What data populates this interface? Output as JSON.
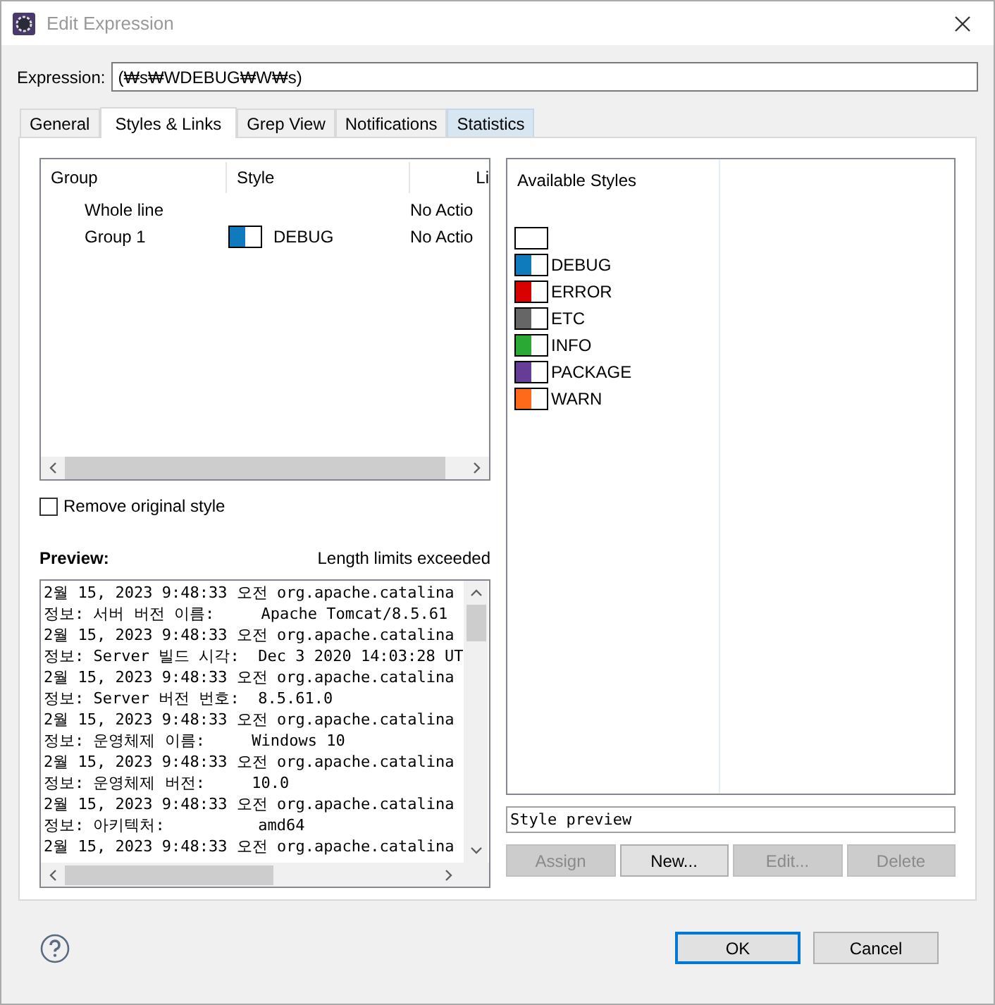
{
  "window": {
    "title": "Edit Expression"
  },
  "expression": {
    "label": "Expression:",
    "value": "(₩s₩WDEBUG₩W₩s)"
  },
  "tabs": [
    {
      "label": "General",
      "selected": false,
      "hovered": false
    },
    {
      "label": "Styles & Links",
      "selected": true,
      "hovered": false
    },
    {
      "label": "Grep View",
      "selected": false,
      "hovered": false
    },
    {
      "label": "Notifications",
      "selected": false,
      "hovered": false
    },
    {
      "label": "Statistics",
      "selected": false,
      "hovered": true
    }
  ],
  "groups_table": {
    "columns": [
      "Group",
      "Style",
      "Li"
    ],
    "rows": [
      {
        "group": "Whole line",
        "link": "No Actio"
      },
      {
        "group": "Group 1",
        "style": {
          "name": "DEBUG",
          "color": "#0f7bbd"
        },
        "link": "No Actio"
      }
    ]
  },
  "remove_original_style": {
    "label": "Remove original style",
    "checked": false
  },
  "preview": {
    "label": "Preview:",
    "warning": "Length limits exceeded",
    "lines": [
      "2월 15, 2023 9:48:33 오전 org.apache.catalina",
      "정보: 서버 버전 이름:     Apache Tomcat/8.5.61",
      "2월 15, 2023 9:48:33 오전 org.apache.catalina",
      "정보: Server 빌드 시각:  Dec 3 2020 14:03:28 UT",
      "2월 15, 2023 9:48:33 오전 org.apache.catalina",
      "정보: Server 버전 번호:  8.5.61.0",
      "2월 15, 2023 9:48:33 오전 org.apache.catalina",
      "정보: 운영체제 이름:     Windows 10",
      "2월 15, 2023 9:48:33 오전 org.apache.catalina",
      "정보: 운영체제 버전:     10.0",
      "2월 15, 2023 9:48:33 오전 org.apache.catalina",
      "정보: 아키텍처:          amd64",
      "2월 15, 2023 9:48:33 오전 org.apache.catalina"
    ]
  },
  "available_styles": {
    "title": "Available Styles",
    "items": [
      {
        "color": "#ffffff"
      },
      {
        "name": "DEBUG",
        "color": "#0f7bbd"
      },
      {
        "name": "ERROR",
        "color": "#d90000"
      },
      {
        "name": "ETC",
        "color": "#666666"
      },
      {
        "name": "INFO",
        "color": "#2aaa35"
      },
      {
        "name": "PACKAGE",
        "color": "#663d96"
      },
      {
        "name": "WARN",
        "color": "#ff6a1a"
      }
    ]
  },
  "style_preview": {
    "value": "Style preview"
  },
  "style_buttons": [
    {
      "label": "Assign",
      "disabled": true
    },
    {
      "label": "New...",
      "disabled": false
    },
    {
      "label": "Edit...",
      "disabled": true
    },
    {
      "label": "Delete",
      "disabled": true
    }
  ],
  "dialog_buttons": [
    {
      "label": "OK",
      "default": true
    },
    {
      "label": "Cancel",
      "default": false
    }
  ]
}
